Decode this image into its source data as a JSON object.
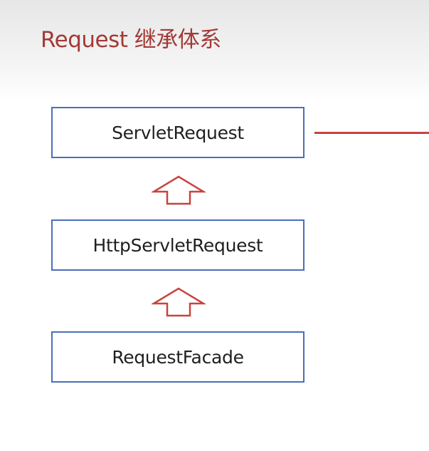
{
  "title": "Request 继承体系",
  "classes": [
    {
      "name": "ServletRequest"
    },
    {
      "name": "HttpServletRequest"
    },
    {
      "name": "RequestFacade"
    }
  ],
  "colors": {
    "title": "#a33a36",
    "box_border": "#4a6fb8",
    "arrow": "#c8433f",
    "side_line": "#c8433f"
  },
  "arrows": [
    {
      "from": "HttpServletRequest",
      "to": "ServletRequest",
      "kind": "inheritance"
    },
    {
      "from": "RequestFacade",
      "to": "HttpServletRequest",
      "kind": "inheritance"
    }
  ]
}
